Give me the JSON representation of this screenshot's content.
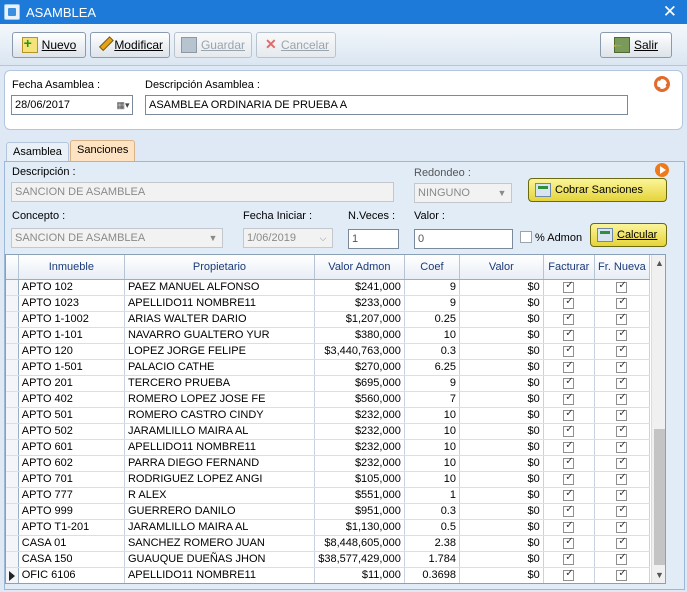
{
  "window": {
    "title": "ASAMBLEA",
    "close_glyph": "✕"
  },
  "toolbar": {
    "nuevo": "Nuevo",
    "modificar": "Modificar",
    "guardar": "Guardar",
    "cancelar": "Cancelar",
    "salir": "Salir"
  },
  "header": {
    "fecha_label": "Fecha Asamblea :",
    "fecha_value": "28/06/2017",
    "descripcion_label": "Descripción Asamblea :",
    "descripcion_value": "ASAMBLEA ORDINARIA DE PRUEBA A"
  },
  "tabs": [
    {
      "label": "Asamblea",
      "active": false
    },
    {
      "label": "Sanciones",
      "active": true
    }
  ],
  "sanciones": {
    "descripcion_label": "Descripción :",
    "descripcion_placeholder": "SANCION DE ASAMBLEA",
    "redondeo_label": "Redondeo :",
    "redondeo_value": "NINGUNO",
    "cobrar_button": "Cobrar Sanciones",
    "concepto_label": "Concepto :",
    "concepto_value": "SANCION DE ASAMBLEA",
    "fecha_iniciar_label": "Fecha Iniciar :",
    "fecha_iniciar_value": "1/06/2019",
    "nveces_label": "N.Veces :",
    "nveces_value": "1",
    "valor_label": "Valor :",
    "valor_value": "0",
    "admon_label": "% Admon",
    "admon_checked": false,
    "calcular_button": "Calcular"
  },
  "grid": {
    "columns": [
      "Inmueble",
      "Propietario",
      "Valor Admon",
      "Coef",
      "Valor",
      "Facturar",
      "Fr. Nueva"
    ],
    "rows": [
      {
        "inmueble": "APTO 102",
        "propietario": "PAEZ  MANUEL ALFONSO",
        "valor_admon": "$241,000",
        "coef": "9",
        "valor": "$0",
        "facturar": true,
        "fr_nueva": true
      },
      {
        "inmueble": "APTO 1023",
        "propietario": "APELLIDO11  NOMBRE11",
        "valor_admon": "$233,000",
        "coef": "9",
        "valor": "$0",
        "facturar": true,
        "fr_nueva": true
      },
      {
        "inmueble": "APTO 1-1002",
        "propietario": "ARIAS  WALTER DARIO",
        "valor_admon": "$1,207,000",
        "coef": "0.25",
        "valor": "$0",
        "facturar": true,
        "fr_nueva": true
      },
      {
        "inmueble": "APTO 1-101",
        "propietario": "NAVARRO GUALTERO YUR",
        "valor_admon": "$380,000",
        "coef": "10",
        "valor": "$0",
        "facturar": true,
        "fr_nueva": true
      },
      {
        "inmueble": "APTO 120",
        "propietario": "LOPEZ  JORGE FELIPE",
        "valor_admon": "$3,440,763,000",
        "coef": "0.3",
        "valor": "$0",
        "facturar": true,
        "fr_nueva": true
      },
      {
        "inmueble": "APTO 1-501",
        "propietario": "PALACIO  CATHE",
        "valor_admon": "$270,000",
        "coef": "6.25",
        "valor": "$0",
        "facturar": true,
        "fr_nueva": true
      },
      {
        "inmueble": "APTO 201",
        "propietario": "TERCERO  PRUEBA",
        "valor_admon": "$695,000",
        "coef": "9",
        "valor": "$0",
        "facturar": true,
        "fr_nueva": true
      },
      {
        "inmueble": "APTO 402",
        "propietario": "ROMERO LOPEZ JOSE FE",
        "valor_admon": "$560,000",
        "coef": "7",
        "valor": "$0",
        "facturar": true,
        "fr_nueva": true
      },
      {
        "inmueble": "APTO 501",
        "propietario": "ROMERO CASTRO CINDY",
        "valor_admon": "$232,000",
        "coef": "10",
        "valor": "$0",
        "facturar": true,
        "fr_nueva": true
      },
      {
        "inmueble": "APTO 502",
        "propietario": "JARAMLILLO  MAIRA AL",
        "valor_admon": "$232,000",
        "coef": "10",
        "valor": "$0",
        "facturar": true,
        "fr_nueva": true
      },
      {
        "inmueble": "APTO 601",
        "propietario": "APELLIDO11  NOMBRE11",
        "valor_admon": "$232,000",
        "coef": "10",
        "valor": "$0",
        "facturar": true,
        "fr_nueva": true
      },
      {
        "inmueble": "APTO 602",
        "propietario": "PARRA  DIEGO FERNAND",
        "valor_admon": "$232,000",
        "coef": "10",
        "valor": "$0",
        "facturar": true,
        "fr_nueva": true
      },
      {
        "inmueble": "APTO 701",
        "propietario": "RODRIGUEZ LOPEZ ANGI",
        "valor_admon": "$105,000",
        "coef": "10",
        "valor": "$0",
        "facturar": true,
        "fr_nueva": true
      },
      {
        "inmueble": "APTO 777",
        "propietario": "R  ALEX",
        "valor_admon": "$551,000",
        "coef": "1",
        "valor": "$0",
        "facturar": true,
        "fr_nueva": true
      },
      {
        "inmueble": "APTO 999",
        "propietario": "GUERRERO  DANILO",
        "valor_admon": "$951,000",
        "coef": "0.3",
        "valor": "$0",
        "facturar": true,
        "fr_nueva": true
      },
      {
        "inmueble": "APTO T1-201",
        "propietario": "JARAMLILLO  MAIRA AL",
        "valor_admon": "$1,130,000",
        "coef": "0.5",
        "valor": "$0",
        "facturar": true,
        "fr_nueva": true
      },
      {
        "inmueble": "CASA 01",
        "propietario": "SANCHEZ ROMERO JUAN",
        "valor_admon": "$8,448,605,000",
        "coef": "2.38",
        "valor": "$0",
        "facturar": true,
        "fr_nueva": true
      },
      {
        "inmueble": "CASA 150",
        "propietario": "GUAUQUE DUEÑAS JHON",
        "valor_admon": "$38,577,429,000",
        "coef": "1.784",
        "valor": "$0",
        "facturar": true,
        "fr_nueva": true
      },
      {
        "inmueble": "OFIC 6106",
        "propietario": "APELLIDO11  NOMBRE11",
        "valor_admon": "$11,000",
        "coef": "0.3698",
        "valor": "$0",
        "facturar": true,
        "fr_nueva": true,
        "current": true
      }
    ]
  }
}
